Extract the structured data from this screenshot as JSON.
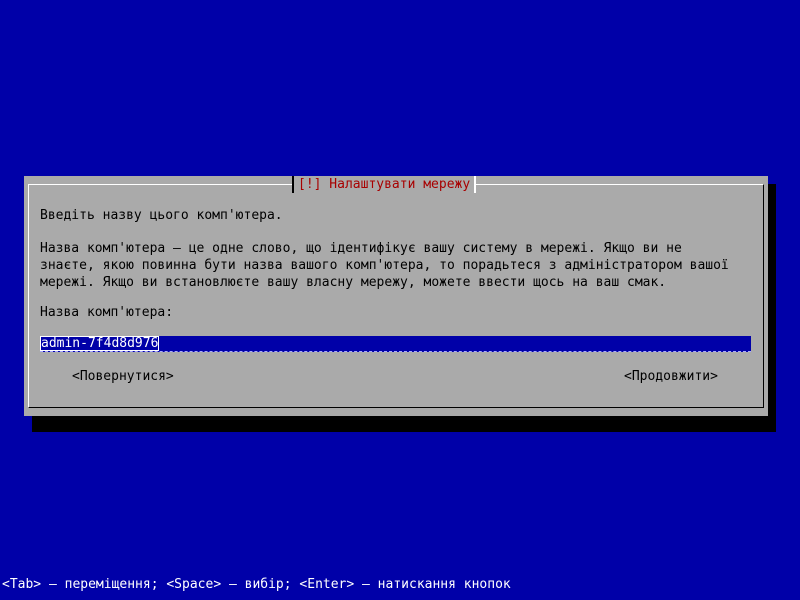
{
  "dialog": {
    "title": "[!] Налаштувати мережу",
    "prompt": "Введіть назву цього комп'ютера.",
    "description": "Назва комп'ютера – це одне слово, що ідентифікує вашу систему в мережі. Якщо ви не\nзнаєте, якою повинна бути назва вашого комп'ютера, то порадьтеся з адміністратором вашої\nмережі. Якщо ви встановлюєте вашу власну мережу, можете ввести щось на ваш смак.",
    "field_label": "Назва комп'ютера:",
    "hostname_value": "admin-7f4d8d976",
    "back_label": "<Повернутися>",
    "continue_label": "<Продовжити>"
  },
  "footer": {
    "hint": "<Tab> – переміщення; <Space> – вибір; <Enter> – натискання кнопок"
  },
  "colors": {
    "background": "#0000a8",
    "dialog": "#aaaaaa",
    "title": "#a80000",
    "text": "#000000",
    "footer_text": "#ffffff"
  }
}
